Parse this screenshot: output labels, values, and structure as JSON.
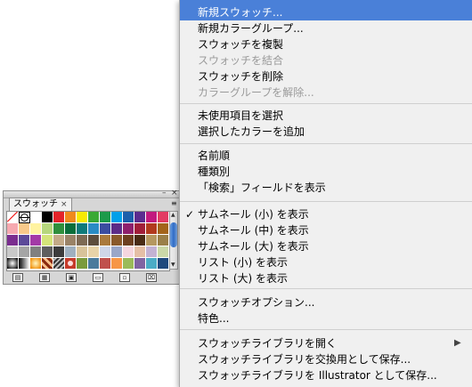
{
  "panel": {
    "tab_label": "スウォッチ",
    "tab_close": "×",
    "minimize_glyph": "–",
    "close_glyph": "×",
    "menu_glyph": "≡",
    "swatches": [
      "none",
      "registration",
      "#ffffff",
      "#000000",
      "#e4232a",
      "#f08a1c",
      "#f7ea00",
      "#3aa935",
      "#1c9a4a",
      "#00a0e9",
      "#1b5fab",
      "#5b2c8f",
      "#c2197f",
      "#e23c63",
      "#f6a9b0",
      "#f7c98a",
      "#fff3a0",
      "#b6d77d",
      "#2f8f3c",
      "#0a6e3a",
      "#0e7a7a",
      "#2a8bc4",
      "#3b4da0",
      "#5c2c87",
      "#8e1f6d",
      "#a11e3a",
      "#b23a1e",
      "#a3641a",
      "#7a2d8f",
      "#5c4a99",
      "#a33aa7",
      "#d4e47a",
      "#c3aa88",
      "#9a8367",
      "#7d6a54",
      "#5d4d3d",
      "#aa7a3d",
      "#8a5a2a",
      "#6d4020",
      "#4a2c15",
      "#b59860",
      "#9a7f48",
      "#c9c9c9",
      "#a5a5a5",
      "#808080",
      "#5e5e5e",
      "#3c3c3c",
      "#9fb0bf",
      "#d8c39a",
      "#e8d3a8",
      "#cfd6e8",
      "#9aa7c8",
      "#f5d6df",
      "#e5bfa6",
      "#c3b2d3",
      "#cbd8a8",
      "grad-radial",
      "grad-linear",
      "grad-orange",
      "pattern-a",
      "pattern-b",
      "pattern-c",
      "#7a9a3b",
      "#4a7a9c",
      "#c0504d",
      "#f79646",
      "#9bbb59",
      "#8064a2",
      "#4bacc6",
      "#1f497d"
    ],
    "bottom_buttons": [
      "library-menu-icon",
      "show-kinds-icon",
      "swatch-options-icon",
      "new-color-group-icon",
      "new-swatch-icon",
      "trash-icon"
    ]
  },
  "menu": {
    "items": [
      {
        "label": "新規スウォッチ...",
        "state": "highlighted"
      },
      {
        "label": "新規カラーグループ...",
        "state": "normal"
      },
      {
        "label": "スウォッチを複製",
        "state": "normal"
      },
      {
        "label": "スウォッチを結合",
        "state": "disabled"
      },
      {
        "label": "スウォッチを削除",
        "state": "normal"
      },
      {
        "label": "カラーグループを解除...",
        "state": "disabled"
      },
      {
        "label": "未使用項目を選択",
        "state": "normal"
      },
      {
        "label": "選択したカラーを追加",
        "state": "normal"
      },
      {
        "label": "名前順",
        "state": "normal"
      },
      {
        "label": "種類別",
        "state": "normal"
      },
      {
        "label": "「検索」フィールドを表示",
        "state": "normal"
      },
      {
        "label": "サムネール (小) を表示",
        "state": "checked"
      },
      {
        "label": "サムネール (中) を表示",
        "state": "normal"
      },
      {
        "label": "サムネール (大) を表示",
        "state": "normal"
      },
      {
        "label": "リスト (小) を表示",
        "state": "normal"
      },
      {
        "label": "リスト (大) を表示",
        "state": "normal"
      },
      {
        "label": "スウォッチオプション...",
        "state": "normal"
      },
      {
        "label": "特色...",
        "state": "normal"
      },
      {
        "label": "スウォッチライブラリを開く",
        "state": "submenu"
      },
      {
        "label": "スウォッチライブラリを交換用として保存...",
        "state": "normal"
      },
      {
        "label": "スウォッチライブラリを Illustrator として保存...",
        "state": "normal"
      }
    ],
    "check_glyph": "✓",
    "submenu_glyph": "▶"
  }
}
